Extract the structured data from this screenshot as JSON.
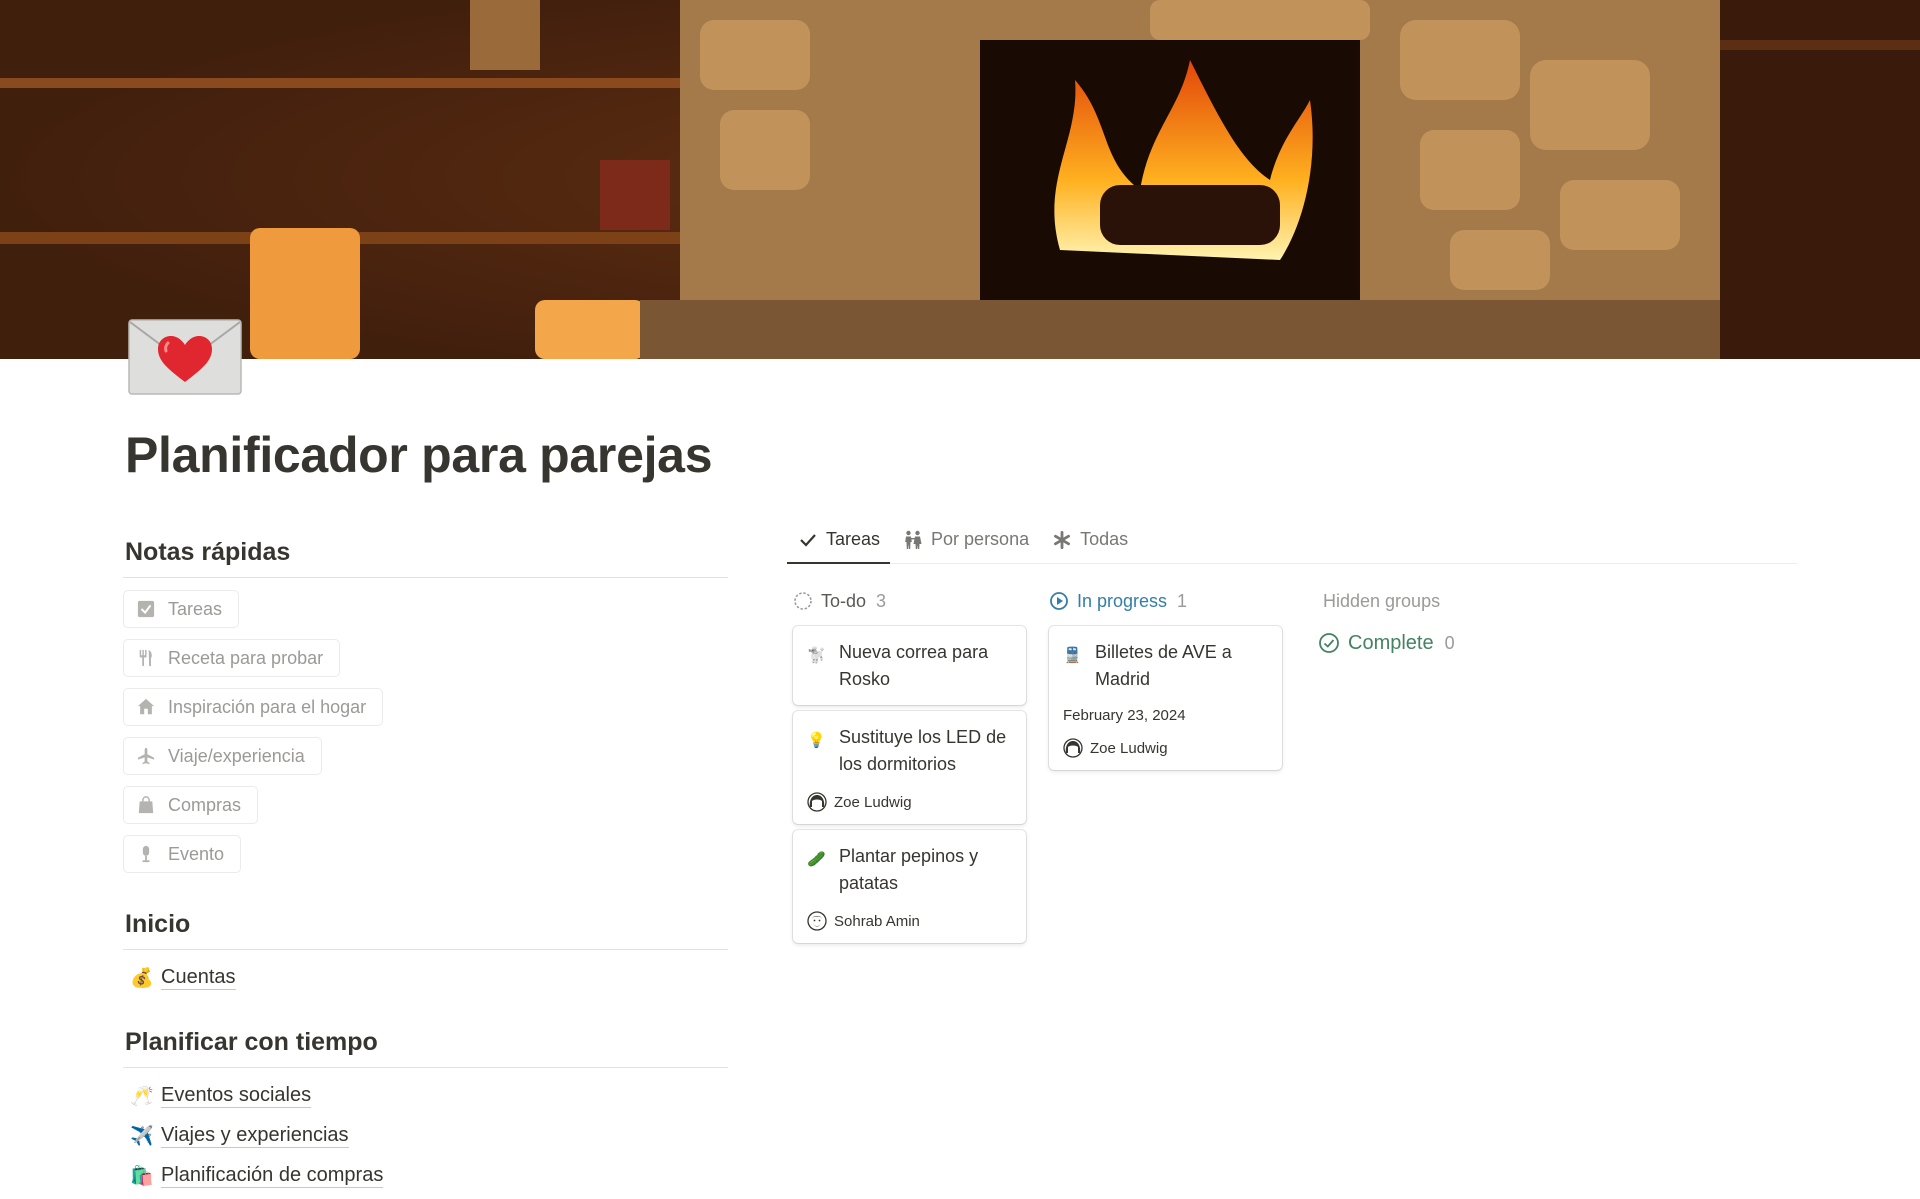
{
  "page": {
    "title": "Planificador para parejas",
    "icon": "love-letter-icon"
  },
  "quick_notes": {
    "heading": "Notas rápidas",
    "buttons": [
      {
        "label": "Tareas",
        "icon": "checkbox-icon"
      },
      {
        "label": "Receta para probar",
        "icon": "fork-knife-icon"
      },
      {
        "label": "Inspiración para el hogar",
        "icon": "house-icon"
      },
      {
        "label": "Viaje/experiencia",
        "icon": "airplane-icon"
      },
      {
        "label": "Compras",
        "icon": "shopping-bag-icon"
      },
      {
        "label": "Evento",
        "icon": "microphone-icon"
      }
    ]
  },
  "inicio": {
    "heading": "Inicio",
    "links": [
      {
        "label": "Cuentas",
        "emoji": "💰"
      }
    ]
  },
  "planificar": {
    "heading": "Planificar con tiempo",
    "links": [
      {
        "label": "Eventos sociales",
        "emoji": "🥂"
      },
      {
        "label": "Viajes y experiencias",
        "emoji": "✈️"
      },
      {
        "label": "Planificación de compras",
        "emoji": "🛍️"
      }
    ]
  },
  "board": {
    "tabs": [
      {
        "label": "Tareas",
        "icon": "check-icon",
        "active": true
      },
      {
        "label": "Por persona",
        "icon": "people-icon",
        "active": false
      },
      {
        "label": "Todas",
        "icon": "asterisk-icon",
        "active": false
      }
    ],
    "groups": [
      {
        "name": "To-do",
        "count": "3",
        "cards": [
          {
            "title": "Nueva correa para Rosko",
            "emoji": "🐩",
            "date": "",
            "person": ""
          },
          {
            "title": "Sustituye los LED de los dormitorios",
            "emoji": "💡",
            "date": "",
            "person": "Zoe Ludwig"
          },
          {
            "title": "Plantar pepinos y patatas",
            "emoji": "🥒",
            "date": "",
            "person": "Sohrab Amin"
          }
        ]
      },
      {
        "name": "In progress",
        "count": "1",
        "cards": [
          {
            "title": "Billetes de AVE a Madrid",
            "emoji": "🚆",
            "date": "February 23, 2024",
            "person": "Zoe Ludwig"
          }
        ]
      }
    ],
    "hidden_groups_label": "Hidden groups",
    "complete": {
      "name": "Complete",
      "count": "0"
    },
    "colors": {
      "in_progress": "#337ea9",
      "complete": "#448361",
      "todo_ring": "#9b9a97"
    }
  }
}
